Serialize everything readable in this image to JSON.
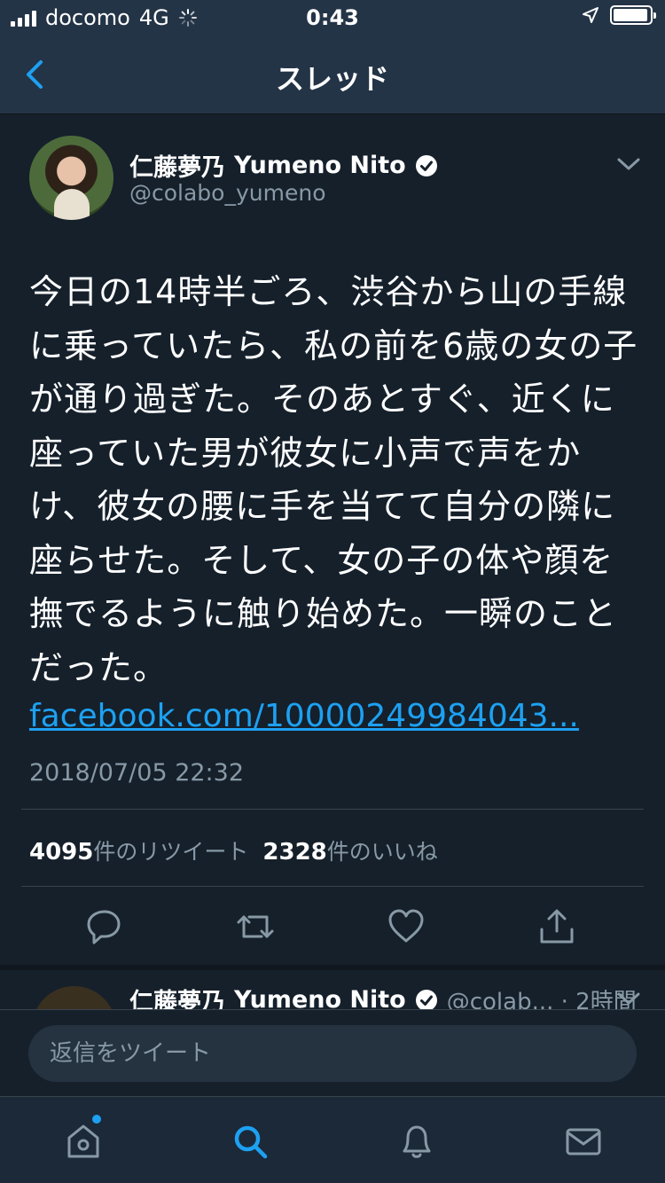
{
  "status_bar": {
    "carrier": "docomo",
    "network": "4G",
    "time": "0:43",
    "battery_level": 0.95
  },
  "header": {
    "title": "スレッド"
  },
  "tweet": {
    "author_name": "仁藤夢乃",
    "author_name_latin": "Yumeno Nito",
    "handle": "@colabo_yumeno",
    "text": "今日の14時半ごろ、渋谷から山の手線に乗っていたら、私の前を6歳の女の子が通り過ぎた。そのあとすぐ、近くに座っていた男が彼女に小声で声をかけ、彼女の腰に手を当てて自分の隣に座らせた。そして、女の子の体や顔を撫でるように触り始めた。一瞬のことだった。",
    "link": "facebook.com/10000249984043...",
    "date": "2018/07/05 22:32",
    "retweet_count": "4095",
    "retweet_label": "件のリツイート",
    "like_count": "2328",
    "like_label": "件のいいね"
  },
  "next_tweet": {
    "author_name": "仁藤夢乃",
    "author_name_latin": "Yumeno Nito",
    "handle_time": "@colab... · 2時間"
  },
  "reply": {
    "placeholder": "返信をツイート"
  },
  "colors": {
    "background": "#15202b",
    "header": "#243447",
    "accent": "#1da1f2",
    "muted": "#8899a6"
  },
  "icons": [
    "back-chevron-icon",
    "verified-icon",
    "chevron-down-icon",
    "reply-icon",
    "retweet-icon",
    "like-icon",
    "share-icon",
    "home-icon",
    "search-icon",
    "notifications-icon",
    "messages-icon"
  ]
}
